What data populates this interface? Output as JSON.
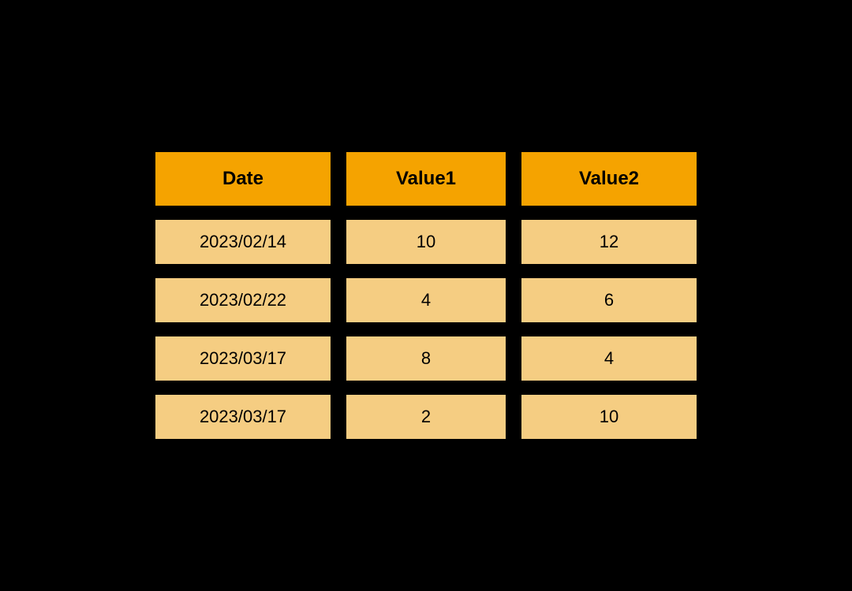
{
  "chart_data": {
    "type": "table",
    "columns": [
      "Date",
      "Value1",
      "Value2"
    ],
    "rows": [
      {
        "Date": "2023/02/14",
        "Value1": 10,
        "Value2": 12
      },
      {
        "Date": "2023/02/22",
        "Value1": 4,
        "Value2": 6
      },
      {
        "Date": "2023/03/17",
        "Value1": 8,
        "Value2": 4
      },
      {
        "Date": "2023/03/17",
        "Value1": 2,
        "Value2": 10
      }
    ]
  },
  "table": {
    "headers": {
      "date": "Date",
      "value1": "Value1",
      "value2": "Value2"
    },
    "rows": [
      {
        "date": "2023/02/14",
        "value1": "10",
        "value2": "12"
      },
      {
        "date": "2023/02/22",
        "value1": "4",
        "value2": "6"
      },
      {
        "date": "2023/03/17",
        "value1": "8",
        "value2": "4"
      },
      {
        "date": "2023/03/17",
        "value1": "2",
        "value2": "10"
      }
    ]
  },
  "colors": {
    "background": "#000000",
    "header_bg": "#f5a300",
    "cell_bg": "#f5cd82",
    "text": "#000000"
  }
}
